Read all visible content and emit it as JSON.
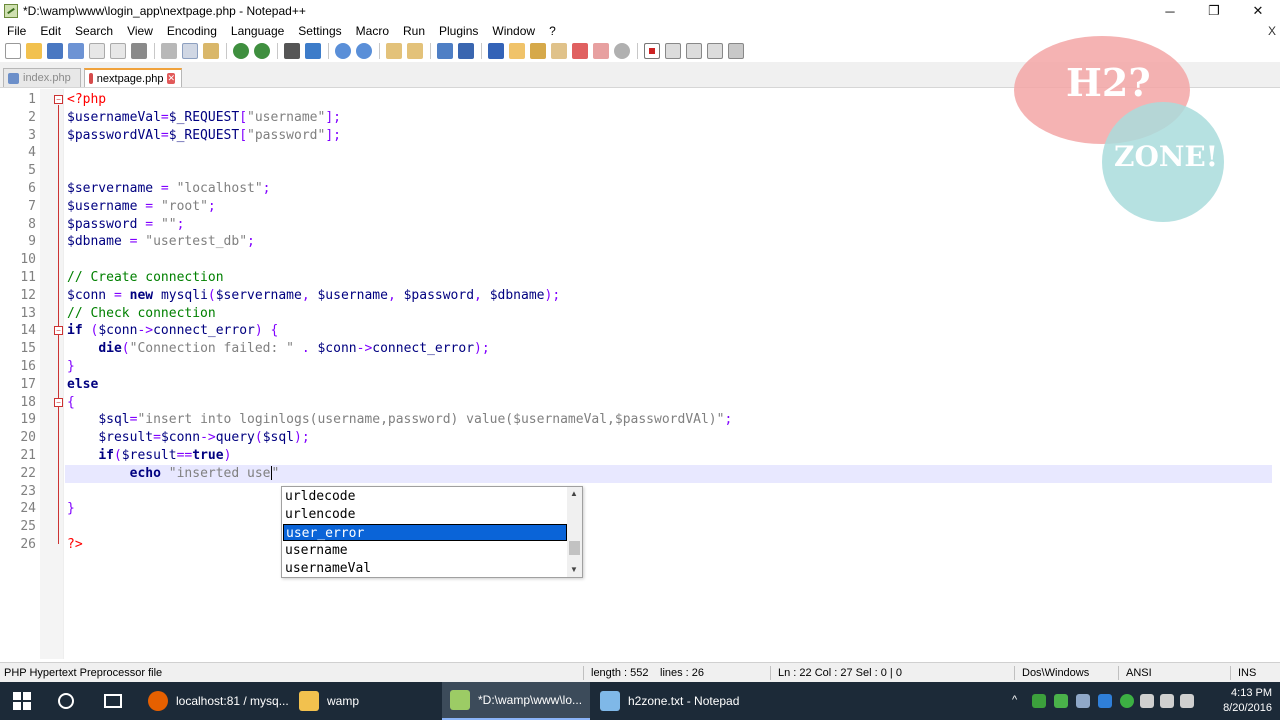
{
  "window": {
    "title": "*D:\\wamp\\www\\login_app\\nextpage.php - Notepad++",
    "controls": {
      "minimize": "─",
      "restore": "❐",
      "close": "✕"
    }
  },
  "menu": {
    "items": [
      "File",
      "Edit",
      "Search",
      "View",
      "Encoding",
      "Language",
      "Settings",
      "Macro",
      "Run",
      "Plugins",
      "Window",
      "?"
    ],
    "close_label": "X"
  },
  "toolbar": {
    "buttons": [
      "new-file-icon",
      "open-file-icon",
      "save-icon",
      "save-all-icon",
      "close-icon",
      "close-all-icon",
      "print-icon",
      "cut-icon",
      "copy-icon",
      "paste-icon",
      "undo-icon",
      "redo-icon",
      "find-icon",
      "replace-icon",
      "zoom-in-icon",
      "zoom-out-icon",
      "sync-v-icon",
      "sync-h-icon",
      "word-wrap-icon",
      "show-all-chars-icon",
      "indent-guide-icon",
      "udl-icon",
      "doc-map-icon",
      "function-list-icon",
      "folder-workspace-icon",
      "monitor-icon",
      "record-macro-icon",
      "stop-record-icon",
      "play-macro-icon",
      "run-macro-multiple-icon",
      "save-macro-icon"
    ]
  },
  "tabs": [
    {
      "label": "index.php",
      "active": false
    },
    {
      "label": "nextpage.php",
      "active": true
    }
  ],
  "editor": {
    "current_line": 22,
    "lines": [
      {
        "n": "1",
        "text": "<?php"
      },
      {
        "n": "2",
        "text": "$usernameVal=$_REQUEST[\"username\"];"
      },
      {
        "n": "3",
        "text": "$passwordVAl=$_REQUEST[\"password\"];"
      },
      {
        "n": "4",
        "text": ""
      },
      {
        "n": "5",
        "text": ""
      },
      {
        "n": "6",
        "text": "$servername = \"localhost\";"
      },
      {
        "n": "7",
        "text": "$username = \"root\";"
      },
      {
        "n": "8",
        "text": "$password = \"\";"
      },
      {
        "n": "9",
        "text": "$dbname = \"usertest_db\";"
      },
      {
        "n": "10",
        "text": ""
      },
      {
        "n": "11",
        "text": "// Create connection"
      },
      {
        "n": "12",
        "text": "$conn = new mysqli($servername, $username, $password, $dbname);"
      },
      {
        "n": "13",
        "text": "// Check connection"
      },
      {
        "n": "14",
        "text": "if ($conn->connect_error) {"
      },
      {
        "n": "15",
        "text": "    die(\"Connection failed: \" . $conn->connect_error);"
      },
      {
        "n": "16",
        "text": "}"
      },
      {
        "n": "17",
        "text": "else"
      },
      {
        "n": "18",
        "text": "{"
      },
      {
        "n": "19",
        "text": "    $sql=\"insert into loginlogs(username,password) value($usernameVal,$passwordVAl)\";"
      },
      {
        "n": "20",
        "text": "    $result=$conn->query($sql);"
      },
      {
        "n": "21",
        "text": "    if($result==true)"
      },
      {
        "n": "22",
        "text": "        echo \"inserted use\""
      },
      {
        "n": "23",
        "text": ""
      },
      {
        "n": "24",
        "text": "}"
      },
      {
        "n": "25",
        "text": ""
      },
      {
        "n": "26",
        "text": "?>"
      }
    ]
  },
  "autocomplete": {
    "items": [
      "urldecode",
      "urlencode",
      "user_error",
      "username",
      "usernameVal"
    ],
    "selected_index": 2,
    "up_arrow": "▲",
    "down_arrow": "▼"
  },
  "watermark": {
    "top": "H2?",
    "bottom": "ZONE!"
  },
  "statusbar": {
    "filetype": "PHP Hypertext Preprocessor file",
    "length": "length : 552",
    "lines": "lines : 26",
    "position": "Ln : 22    Col : 27    Sel : 0 | 0",
    "eol": "Dos\\Windows",
    "encoding": "ANSI",
    "mode": "INS"
  },
  "taskbar": {
    "items": [
      {
        "label": "localhost:81 / mysq...",
        "icon": "firefox-icon",
        "color": "#e66000"
      },
      {
        "label": "wamp",
        "icon": "folder-icon",
        "color": "#f2c14e"
      },
      {
        "label": "*D:\\wamp\\www\\lo...",
        "icon": "notepadpp-icon",
        "color": "#9ccc65"
      },
      {
        "label": "h2zone.txt - Notepad",
        "icon": "notepad-icon",
        "color": "#7fb8e8"
      }
    ],
    "time": "4:13 PM",
    "date": "8/20/2016"
  }
}
